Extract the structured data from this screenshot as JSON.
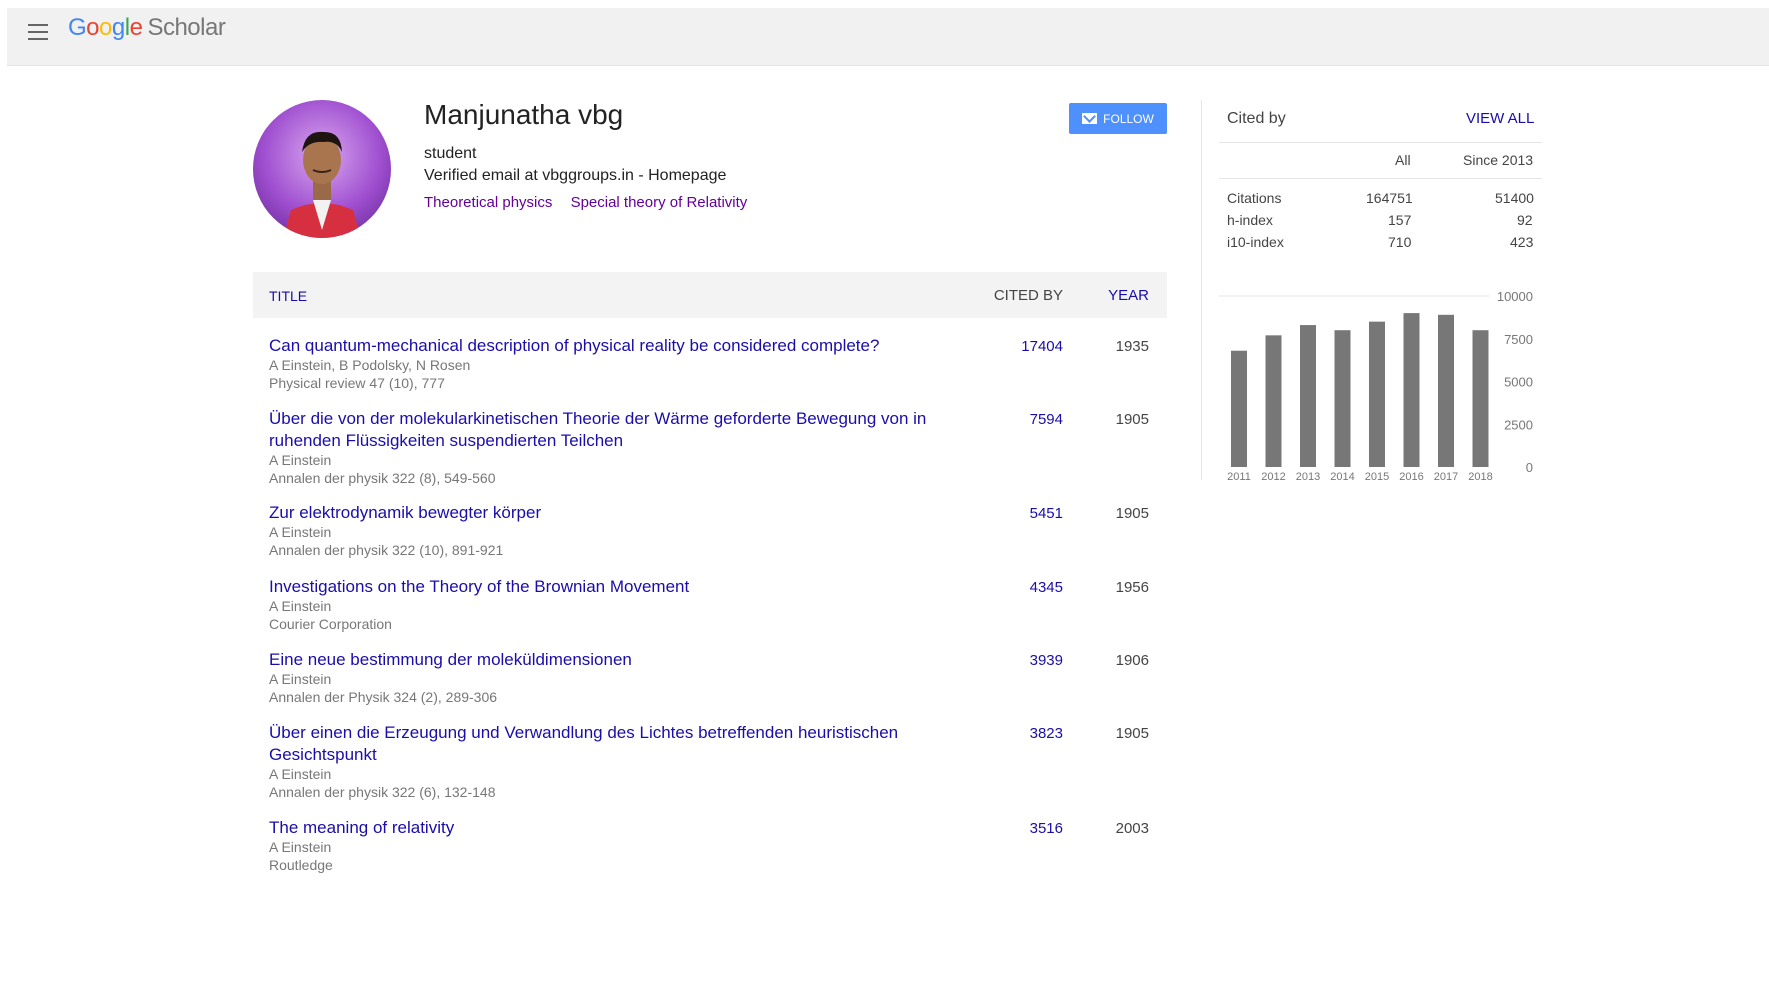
{
  "header": {
    "logo_letters": [
      "G",
      "o",
      "o",
      "g",
      "l",
      "e"
    ],
    "logo_suffix": "Scholar"
  },
  "profile": {
    "name": "Manjunatha vbg",
    "affiliation": "student",
    "email_line": "Verified email at vbggroups.in - Homepage",
    "interests": [
      "Theoretical physics",
      "Special theory of Relativity"
    ],
    "follow_label": "FOLLOW"
  },
  "table": {
    "headers": {
      "title": "TITLE",
      "cited_by": "CITED BY",
      "year": "YEAR"
    },
    "rows": [
      {
        "title": "Can quantum-mechanical description of physical reality be considered complete?",
        "authors": "A Einstein, B Podolsky, N Rosen",
        "venue": "Physical review 47 (10), 777",
        "cited_by": "17404",
        "year": "1935"
      },
      {
        "title": "Über die von der molekularkinetischen Theorie der Wärme geforderte Bewegung von in ruhenden Flüssigkeiten suspendierten Teilchen",
        "authors": "A Einstein",
        "venue": "Annalen der physik 322 (8), 549-560",
        "cited_by": "7594",
        "year": "1905"
      },
      {
        "title": "Zur elektrodynamik bewegter körper",
        "authors": "A Einstein",
        "venue": "Annalen der physik 322 (10), 891-921",
        "cited_by": "5451",
        "year": "1905"
      },
      {
        "title": "Investigations on the Theory of the Brownian Movement",
        "authors": "A Einstein",
        "venue": "Courier Corporation",
        "cited_by": "4345",
        "year": "1956"
      },
      {
        "title": "Eine neue bestimmung der moleküldimensionen",
        "authors": "A Einstein",
        "venue": "Annalen der Physik 324 (2), 289-306",
        "cited_by": "3939",
        "year": "1906"
      },
      {
        "title": "Über einen die Erzeugung und Verwandlung des Lichtes betreffenden heuristischen Gesichtspunkt",
        "authors": "A Einstein",
        "venue": "Annalen der physik 322 (6), 132-148",
        "cited_by": "3823",
        "year": "1905"
      },
      {
        "title": "The meaning of relativity",
        "authors": "A Einstein",
        "venue": "Routledge",
        "cited_by": "3516",
        "year": "2003"
      }
    ]
  },
  "cited_by": {
    "title": "Cited by",
    "view_all": "VIEW ALL",
    "col_all": "All",
    "col_since": "Since 2013",
    "stats": [
      {
        "label": "Citations",
        "all": "164751",
        "since": "51400"
      },
      {
        "label": "h-index",
        "all": "157",
        "since": "92"
      },
      {
        "label": "i10-index",
        "all": "710",
        "since": "423"
      }
    ]
  },
  "chart_data": {
    "type": "bar",
    "categories": [
      "2011",
      "2012",
      "2013",
      "2014",
      "2015",
      "2016",
      "2017",
      "2018"
    ],
    "values": [
      6800,
      7700,
      8300,
      8000,
      8500,
      9000,
      8900,
      8000
    ],
    "y_ticks": [
      "10000",
      "7500",
      "5000",
      "2500",
      "0"
    ],
    "ylim": [
      0,
      10000
    ],
    "bar_color": "#777777"
  },
  "colors": {
    "link": "#1a0dab",
    "interest": "#660099",
    "button": "#4d90fe"
  }
}
